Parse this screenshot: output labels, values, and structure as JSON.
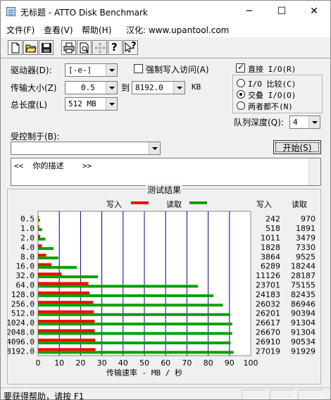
{
  "window": {
    "title": "无标题 - ATTO Disk Benchmark",
    "minimize": "─",
    "maximize": "☐",
    "close": "✕"
  },
  "menu": [
    {
      "label": "文件(F)"
    },
    {
      "label": "查看(V)"
    },
    {
      "label": "帮助(H)"
    },
    {
      "label": "汉化: www.upantool.com"
    }
  ],
  "toolbar": {
    "icons": [
      "new-file-icon",
      "open-folder-icon",
      "save-icon",
      "print-icon",
      "print-preview-icon",
      "move-icon",
      "help-icon",
      "context-help-icon"
    ],
    "help_label": "?",
    "context_help_label": "?"
  },
  "settings": {
    "drive_label": "驱动器(D):",
    "drive_value": "[-e-]",
    "force_write_label": "强制写入访问(A)",
    "transfer_size_label": "传输大小(Z)",
    "transfer_from": "0.5",
    "to_label": "到",
    "transfer_to": "8192.0",
    "kb_label": "KB",
    "total_length_label": "总长度(L)",
    "total_length_value": "512 MB",
    "controlled_by_label": "受控制于(B):",
    "controlled_by_value": "",
    "description_text": "<<  你的描述    >>",
    "start_button": "开始(S)"
  },
  "io_options": {
    "direct_io_label": "直接 I/O(R)",
    "direct_io_checked": true,
    "compare_label": "I/O 比较(C)",
    "overlap_label": "交叠 I/O(O)",
    "neither_label": "两者都不(N)",
    "selected": "overlap",
    "queue_depth_label": "队列深度(Q):",
    "queue_depth_value": "4"
  },
  "results": {
    "title": "测试结果",
    "legend_write": "写入",
    "legend_read": "读取",
    "col_write": "写入",
    "col_read": "读取",
    "colors": {
      "write": "#ff0000",
      "read": "#00a000",
      "grid": "#0000aa"
    }
  },
  "chart_data": {
    "type": "bar",
    "orientation": "horizontal",
    "xlabel": "传输速率 - MB / 秒",
    "xlim": [
      0,
      100
    ],
    "xticks": [
      "0",
      "10",
      "20",
      "30",
      "40",
      "50",
      "60",
      "70",
      "80",
      "90",
      "100"
    ],
    "categories": [
      "0.5",
      "1.0",
      "2.0",
      "4.0",
      "8.0",
      "16.0",
      "32.0",
      "64.0",
      "128.0",
      "256.0",
      "512.0",
      "1024.0",
      "2048.0",
      "4096.0",
      "8192.0"
    ],
    "series": [
      {
        "name": "写入",
        "values": [
          0.24,
          0.52,
          1.01,
          1.83,
          3.86,
          6.29,
          11.13,
          23.7,
          24.18,
          26.03,
          26.2,
          26.62,
          26.67,
          26.91,
          27.02
        ]
      },
      {
        "name": "读取",
        "values": [
          0.97,
          1.89,
          3.48,
          7.33,
          9.53,
          18.24,
          28.19,
          75.16,
          82.44,
          86.95,
          90.39,
          91.3,
          91.3,
          90.53,
          91.93
        ]
      }
    ],
    "write_kbs": [
      "242",
      "518",
      "1011",
      "1828",
      "3864",
      "6289",
      "11126",
      "23701",
      "24183",
      "26032",
      "26201",
      "26617",
      "26670",
      "26910",
      "27019"
    ],
    "read_kbs": [
      "970",
      "1891",
      "3479",
      "7330",
      "9525",
      "18244",
      "28187",
      "75155",
      "82435",
      "86946",
      "90394",
      "91304",
      "91304",
      "90534",
      "91929"
    ]
  },
  "status": {
    "text": "要获得帮助，请按 F1"
  }
}
